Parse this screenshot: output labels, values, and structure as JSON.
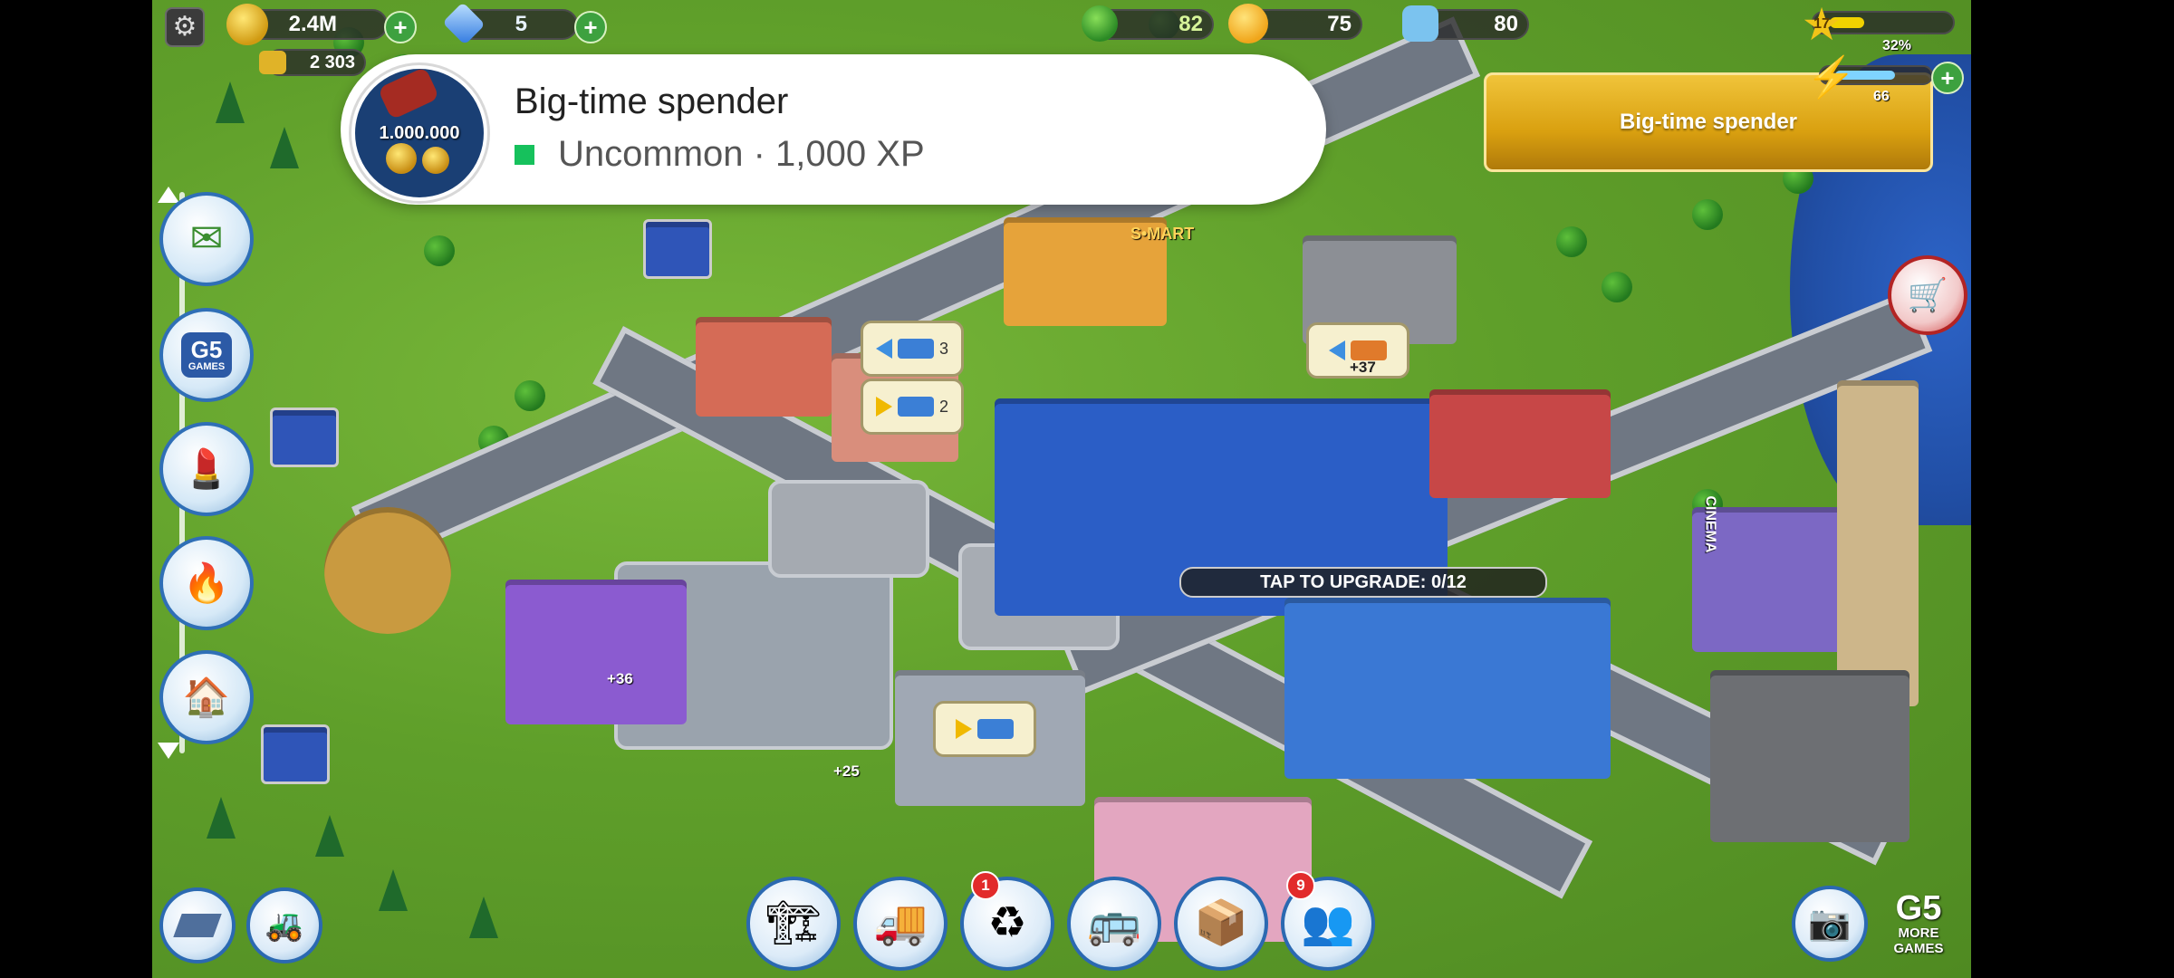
{
  "hud": {
    "coins": "2.4M",
    "gems": "5",
    "secondary_coins": "2 303",
    "trees": "82",
    "happiness": "75",
    "population": "80",
    "level": "17",
    "xp_percent_label": "32%",
    "xp_progress": 0.32,
    "energy": "66",
    "energy_progress": 0.66
  },
  "notification": {
    "title": "Big-time spender",
    "subtitle": "Uncommon · 1,000 XP",
    "icon_text": "1.000.000",
    "rarity_color": "#16c15c"
  },
  "achievement_banner": {
    "label": "Big-time spender"
  },
  "map": {
    "upgrade_label": "TAP TO UPGRADE: 0/12",
    "store_sign": "S•MART",
    "cinema_sign": "CINEMA",
    "bubble_counts": [
      "3",
      "2"
    ],
    "income_labels": [
      "+36",
      "+25",
      "+37"
    ]
  },
  "side_menu": [
    "mail-button",
    "g5-games-button",
    "shop-button",
    "fire-station-button",
    "housing-button"
  ],
  "bottom_bar": {
    "badges": {
      "recycle": "1",
      "friends": "9"
    },
    "more_games_line1": "MORE",
    "more_games_line2": "GAMES",
    "g5_logo": "G5",
    "g5_games_label": "GAMES"
  }
}
